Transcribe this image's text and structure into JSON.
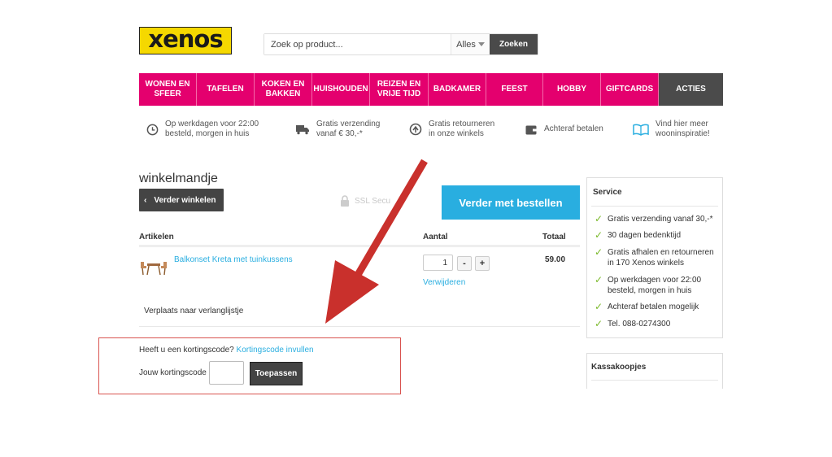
{
  "header": {
    "logo_text": "xenos",
    "search_placeholder": "Zoek op product...",
    "category": "Alles",
    "search_button": "Zoeken"
  },
  "nav": {
    "items": [
      "WONEN EN SFEER",
      "TAFELEN",
      "KOKEN EN BAKKEN",
      "HUISHOUDEN",
      "REIZEN EN VRIJE TIJD",
      "BADKAMER",
      "FEEST",
      "HOBBY",
      "GIFTCARDS",
      "ACTIES"
    ]
  },
  "usps": [
    {
      "icon": "clock-icon",
      "line1": "Op werkdagen voor 22:00",
      "line2": "besteld, morgen in huis"
    },
    {
      "icon": "truck-icon",
      "line1": "Gratis verzending",
      "line2": "vanaf € 30,-*"
    },
    {
      "icon": "return-icon",
      "line1": "Gratis retourneren",
      "line2": "in onze winkels"
    },
    {
      "icon": "wallet-icon",
      "line1": "Achteraf betalen",
      "line2": ""
    },
    {
      "icon": "book-icon",
      "line1": "Vind hier meer",
      "line2": "wooninspiratie!"
    }
  ],
  "cart": {
    "title": "winkelmandje",
    "back_button": "Verder winkelen",
    "ssl_text": "SSL Secu",
    "order_button": "Verder met bestellen",
    "columns": {
      "articles": "Artikelen",
      "quantity": "Aantal",
      "total": "Totaal"
    },
    "item": {
      "name": "Balkonset Kreta met tuinkussens",
      "quantity": "1",
      "minus": "-",
      "plus": "+",
      "remove": "Verwijderen",
      "price": "59.00"
    },
    "wishlist": "Verplaats naar verlanglijstje"
  },
  "coupon": {
    "question": "Heeft u een kortingscode?",
    "link": "Kortingscode invullen",
    "label": "Jouw kortingscode",
    "input_value": "",
    "apply_button": "Toepassen"
  },
  "sidebar": {
    "service_title": "Service",
    "service_items": [
      {
        "line1": "Gratis verzending vanaf 30,-*",
        "line2": ""
      },
      {
        "line1": "30 dagen bedenktijd",
        "line2": ""
      },
      {
        "line1": "Gratis afhalen en retourneren",
        "line2": "in 170 Xenos winkels"
      },
      {
        "line1": "Op werkdagen voor 22:00",
        "line2": "besteld, morgen in huis"
      },
      {
        "line1": "Achteraf betalen mogelijk",
        "line2": ""
      },
      {
        "line1": "Tel. 088-0274300",
        "line2": ""
      }
    ],
    "kassa_title": "Kassakoopjes"
  },
  "colors": {
    "brand_yellow": "#f5d800",
    "nav_pink": "#e4006e",
    "accent_blue": "#29aee0",
    "check_green": "#7ab929",
    "annotation_red": "#c9302c"
  }
}
